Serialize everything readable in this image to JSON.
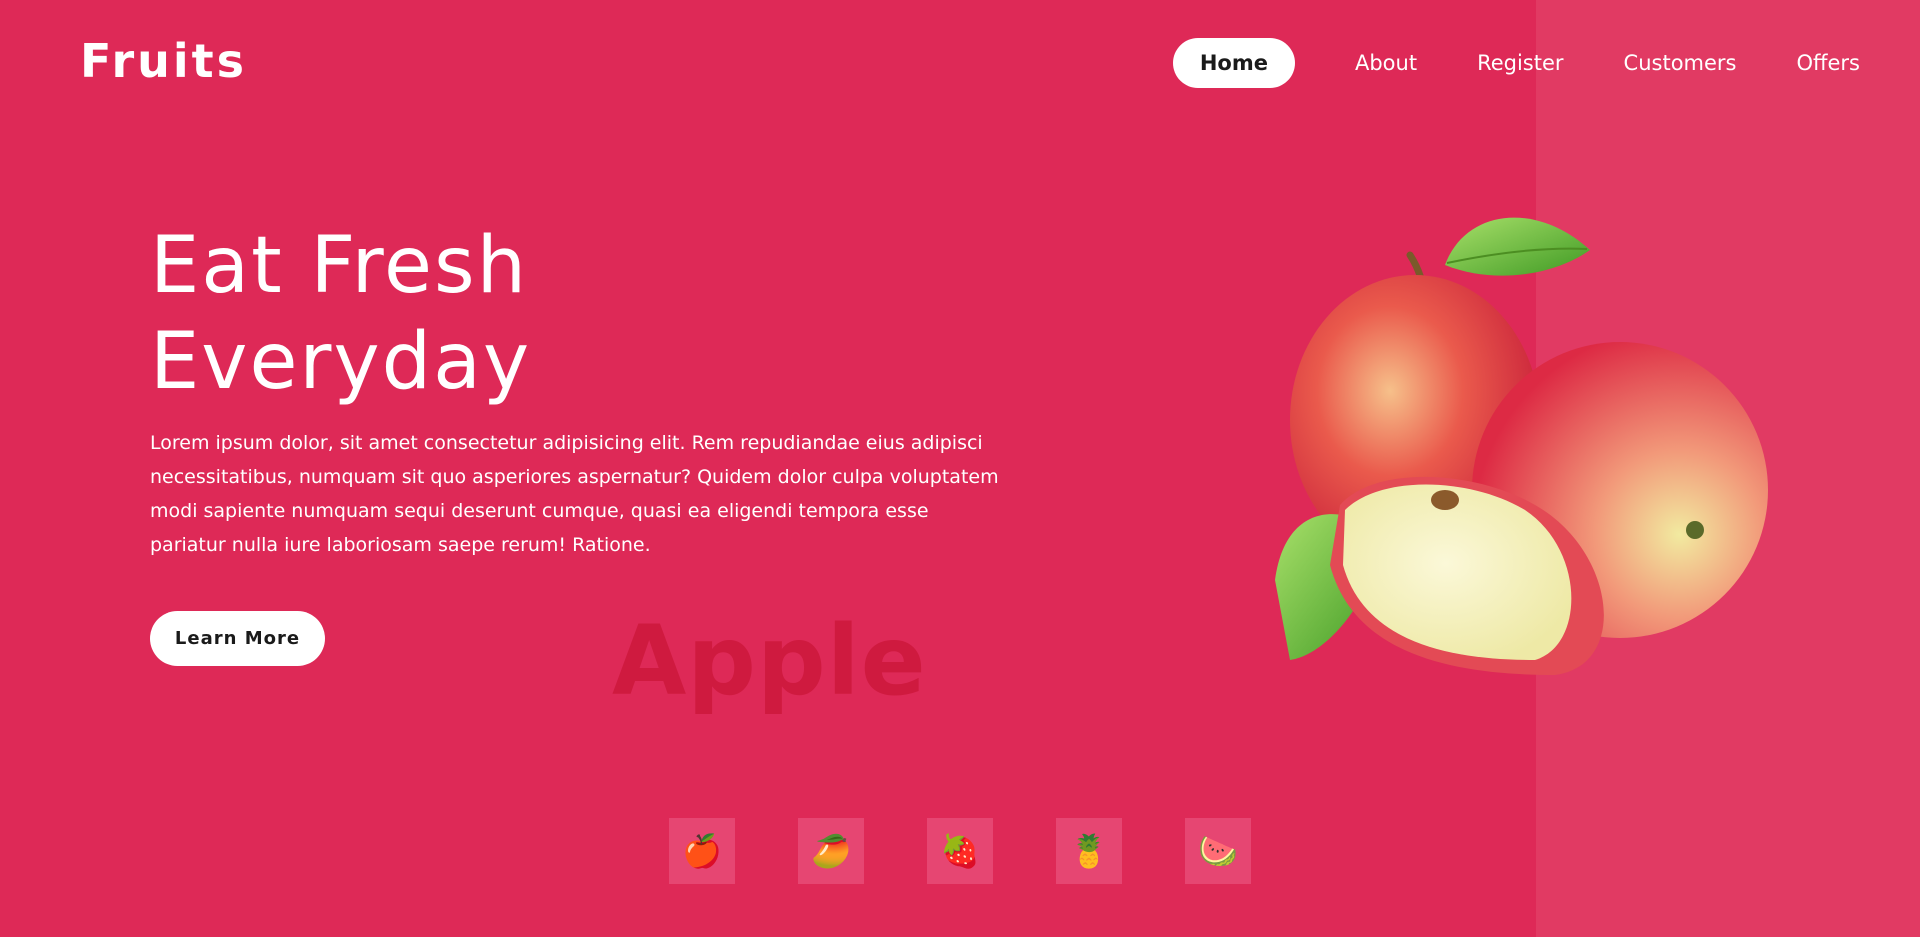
{
  "brand": {
    "logo": "Fruits"
  },
  "nav": {
    "items": [
      {
        "label": "Home",
        "active": true
      },
      {
        "label": "About"
      },
      {
        "label": "Register"
      },
      {
        "label": "Customers"
      },
      {
        "label": "Offers"
      }
    ]
  },
  "hero": {
    "title_line1": "Eat Fresh",
    "title_line2": "Everyday",
    "description": "Lorem ipsum dolor, sit amet consectetur adipisicing elit. Rem repudiandae eius adipisci necessitatibus, numquam sit quo asperiores aspernatur? Quidem dolor culpa voluptatem modi sapiente numquam sequi deserunt cumque, quasi ea eligendi tempora esse pariatur nulla iure laboriosam saepe rerum! Ratione.",
    "cta_label": "Learn More",
    "watermark": "Apple"
  },
  "thumbnails": [
    {
      "icon": "apple-icon",
      "glyph": "🍎"
    },
    {
      "icon": "mango-icon",
      "glyph": "🥭"
    },
    {
      "icon": "dragonfruit-icon",
      "glyph": "🍓"
    },
    {
      "icon": "pineapple-icon",
      "glyph": "🍍"
    },
    {
      "icon": "watermelon-icon",
      "glyph": "🍉"
    }
  ],
  "colors": {
    "background": "#de2957",
    "panel": "#e13a63",
    "watermark": "#cf1a3f",
    "button": "#ffffff"
  }
}
